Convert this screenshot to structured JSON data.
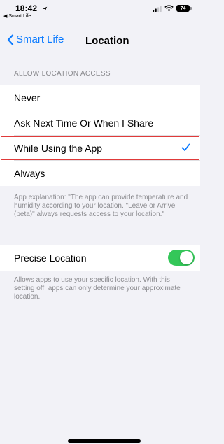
{
  "status_bar": {
    "time": "18:42",
    "back_app_label": "◀ Smart Life",
    "battery": "74"
  },
  "nav": {
    "back_label": "Smart Life",
    "title": "Location"
  },
  "location_access": {
    "header": "ALLOW LOCATION ACCESS",
    "options": [
      {
        "label": "Never",
        "selected": false
      },
      {
        "label": "Ask Next Time Or When I Share",
        "selected": false
      },
      {
        "label": "While Using the App",
        "selected": true
      },
      {
        "label": "Always",
        "selected": false
      }
    ],
    "explanation": "App explanation: \"The app can provide temperature and humidity according to your location. \"Leave or Arrive (beta)\" always requests access to your location.\""
  },
  "precise_location": {
    "label": "Precise Location",
    "enabled": true,
    "note": "Allows apps to use your specific location. With this setting off, apps can only determine your approximate location."
  },
  "colors": {
    "accent": "#0a7aff",
    "toggle_on": "#34c759",
    "highlight": "#e03a3a",
    "background": "#f2f2f7"
  }
}
